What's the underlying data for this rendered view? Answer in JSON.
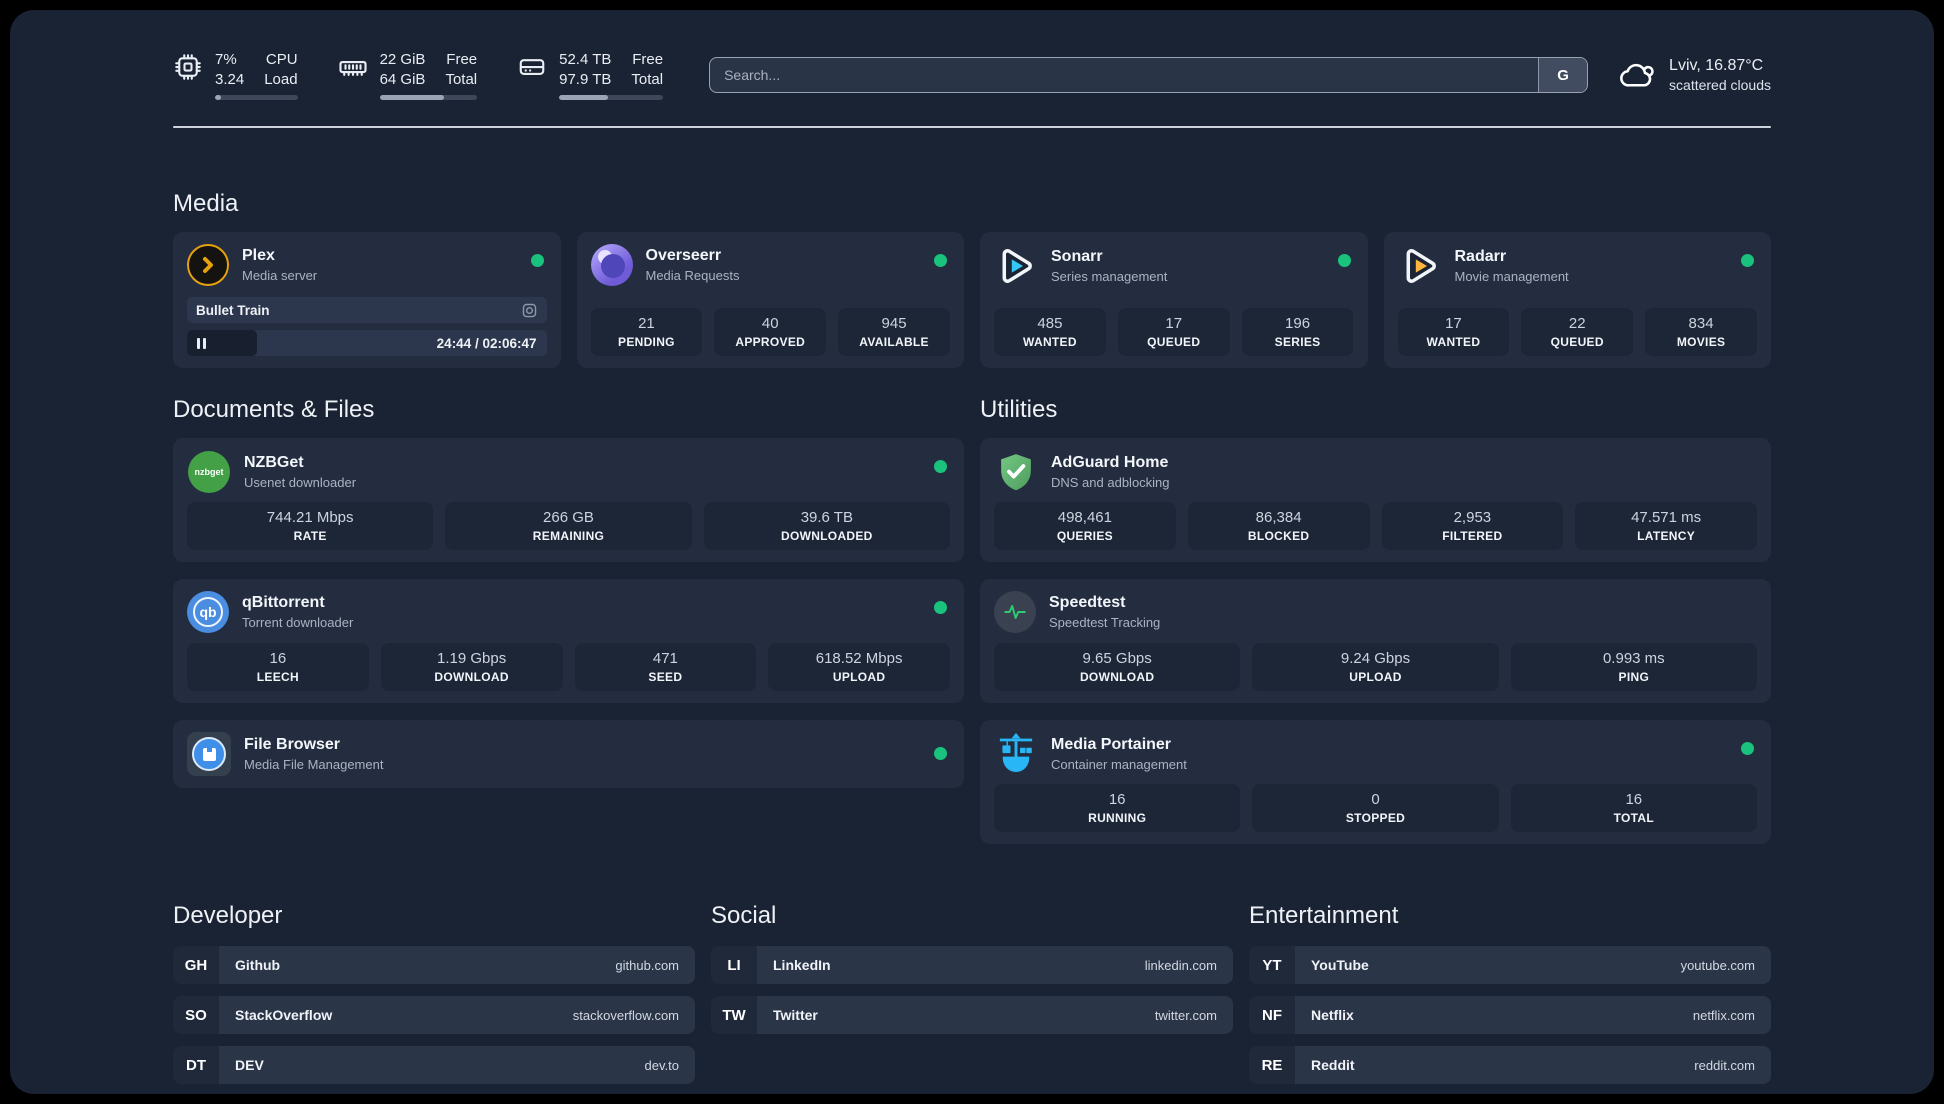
{
  "colors": {
    "background": "#1a2333",
    "card": "#232d3f",
    "stat_tile": "#1c2637",
    "status_online": "#19c37d",
    "accent_plex": "#e5a00d",
    "accent_sonarr": "#35c5f4",
    "accent_radarr": "#ffb53e",
    "accent_adguard": "#5fae6d",
    "accent_portainer": "#29b6f6"
  },
  "topbar": {
    "cpu": {
      "value_top": "7%",
      "value_bottom": "3.24",
      "label_top": "CPU",
      "label_bottom": "Load",
      "progress_pct": 7
    },
    "memory": {
      "value_top": "22 GiB",
      "value_bottom": "64 GiB",
      "label_top": "Free",
      "label_bottom": "Total",
      "progress_pct": 66
    },
    "disk": {
      "value_top": "52.4 TB",
      "value_bottom": "97.9 TB",
      "label_top": "Free",
      "label_bottom": "Total",
      "progress_pct": 47
    },
    "search": {
      "placeholder": "Search...",
      "engine_label": "G"
    },
    "weather": {
      "location_temp": "Lviv, 16.87°C",
      "condition": "scattered clouds"
    }
  },
  "media": {
    "title": "Media",
    "plex": {
      "name": "Plex",
      "subtitle": "Media server",
      "now_playing": "Bullet Train",
      "time_display": "24:44 / 02:06:47",
      "progress_pct": 19.5
    },
    "overseerr": {
      "name": "Overseerr",
      "subtitle": "Media Requests",
      "stats": [
        {
          "value": "21",
          "label": "PENDING"
        },
        {
          "value": "40",
          "label": "APPROVED"
        },
        {
          "value": "945",
          "label": "AVAILABLE"
        }
      ]
    },
    "sonarr": {
      "name": "Sonarr",
      "subtitle": "Series management",
      "stats": [
        {
          "value": "485",
          "label": "WANTED"
        },
        {
          "value": "17",
          "label": "QUEUED"
        },
        {
          "value": "196",
          "label": "SERIES"
        }
      ]
    },
    "radarr": {
      "name": "Radarr",
      "subtitle": "Movie management",
      "stats": [
        {
          "value": "17",
          "label": "WANTED"
        },
        {
          "value": "22",
          "label": "QUEUED"
        },
        {
          "value": "834",
          "label": "MOVIES"
        }
      ]
    }
  },
  "documents": {
    "title": "Documents & Files",
    "nzbget": {
      "name": "NZBGet",
      "subtitle": "Usenet downloader",
      "icon_text": "nzbget",
      "stats": [
        {
          "value": "744.21 Mbps",
          "label": "RATE"
        },
        {
          "value": "266 GB",
          "label": "REMAINING"
        },
        {
          "value": "39.6 TB",
          "label": "DOWNLOADED"
        }
      ]
    },
    "qbittorrent": {
      "name": "qBittorrent",
      "subtitle": "Torrent downloader",
      "icon_text": "qb",
      "stats": [
        {
          "value": "16",
          "label": "LEECH"
        },
        {
          "value": "1.19 Gbps",
          "label": "DOWNLOAD"
        },
        {
          "value": "471",
          "label": "SEED"
        },
        {
          "value": "618.52 Mbps",
          "label": "UPLOAD"
        }
      ]
    },
    "filebrowser": {
      "name": "File Browser",
      "subtitle": "Media File Management"
    }
  },
  "utilities": {
    "title": "Utilities",
    "adguard": {
      "name": "AdGuard Home",
      "subtitle": "DNS and adblocking",
      "stats": [
        {
          "value": "498,461",
          "label": "QUERIES"
        },
        {
          "value": "86,384",
          "label": "BLOCKED"
        },
        {
          "value": "2,953",
          "label": "FILTERED"
        },
        {
          "value": "47.571 ms",
          "label": "LATENCY"
        }
      ]
    },
    "speedtest": {
      "name": "Speedtest",
      "subtitle": "Speedtest Tracking",
      "stats": [
        {
          "value": "9.65 Gbps",
          "label": "DOWNLOAD"
        },
        {
          "value": "9.24 Gbps",
          "label": "UPLOAD"
        },
        {
          "value": "0.993 ms",
          "label": "PING"
        }
      ]
    },
    "portainer": {
      "name": "Media Portainer",
      "subtitle": "Container management",
      "stats": [
        {
          "value": "16",
          "label": "RUNNING"
        },
        {
          "value": "0",
          "label": "STOPPED"
        },
        {
          "value": "16",
          "label": "TOTAL"
        }
      ]
    }
  },
  "bookmarks": {
    "developer": {
      "title": "Developer",
      "items": [
        {
          "abbr": "GH",
          "name": "Github",
          "url": "github.com"
        },
        {
          "abbr": "SO",
          "name": "StackOverflow",
          "url": "stackoverflow.com"
        },
        {
          "abbr": "DT",
          "name": "DEV",
          "url": "dev.to"
        }
      ]
    },
    "social": {
      "title": "Social",
      "items": [
        {
          "abbr": "LI",
          "name": "LinkedIn",
          "url": "linkedin.com"
        },
        {
          "abbr": "TW",
          "name": "Twitter",
          "url": "twitter.com"
        }
      ]
    },
    "entertainment": {
      "title": "Entertainment",
      "items": [
        {
          "abbr": "YT",
          "name": "YouTube",
          "url": "youtube.com"
        },
        {
          "abbr": "NF",
          "name": "Netflix",
          "url": "netflix.com"
        },
        {
          "abbr": "RE",
          "name": "Reddit",
          "url": "reddit.com"
        }
      ]
    }
  }
}
